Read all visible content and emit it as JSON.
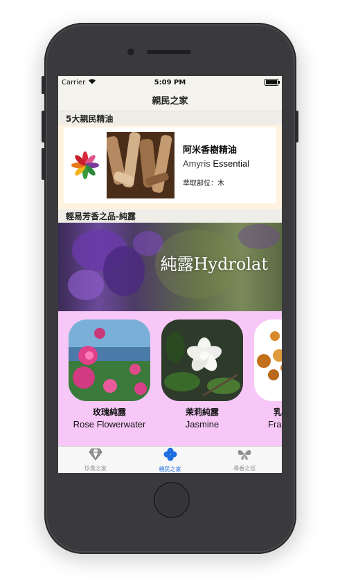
{
  "status_bar": {
    "carrier": "Carrier",
    "time": "5:09 PM"
  },
  "nav": {
    "title": "親民之家"
  },
  "section_oils": {
    "header": "5大親民精油",
    "card": {
      "name_zh": "阿米香樹精油",
      "name_en_latin": "Amyris",
      "name_en_word": "Essential",
      "part": "萃取部位：木"
    }
  },
  "section_hydrolat": {
    "header": "輕易芳香之品-純露",
    "banner_text": "純露Hydrolat",
    "items": [
      {
        "name_zh": "玫瑰純露",
        "name_en": "Rose Flowerwater"
      },
      {
        "name_zh": "茉莉純露",
        "name_en": "Jasmine"
      },
      {
        "name_zh": "乳",
        "name_en": "Fra"
      }
    ]
  },
  "tabbar": {
    "tabs": [
      {
        "label": "珍貴之家",
        "icon": "diamond-icon",
        "active": false
      },
      {
        "label": "親民之家",
        "icon": "clover-icon",
        "active": true
      },
      {
        "label": "尋香之徑",
        "icon": "butterfly-icon",
        "active": false
      }
    ]
  },
  "colors": {
    "accent": "#1f6fe0",
    "card_bg": "#fff2de",
    "hydrolat_bg": "#f7c8f7"
  }
}
